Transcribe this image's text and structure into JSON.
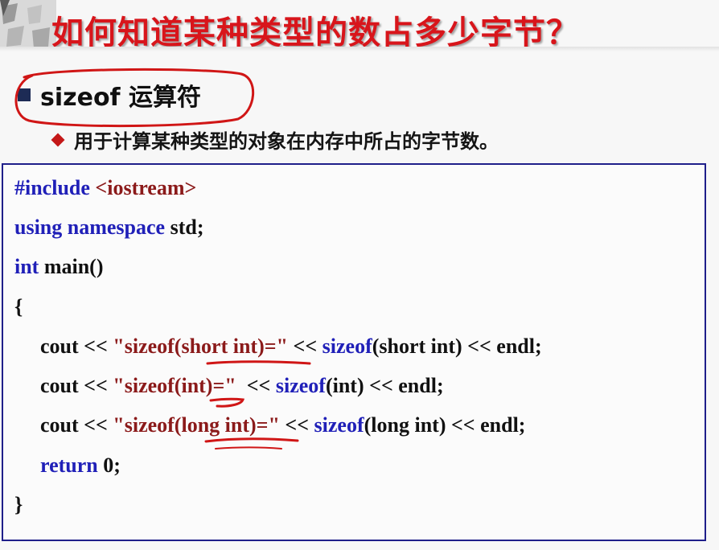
{
  "title": "如何知道某种类型的数占多少字节？",
  "bullet1": "sizeof 运算符",
  "bullet2": "用于计算某种类型的对象在内存中所占的字节数。",
  "code": {
    "l1_pp": "#include",
    "l1_hdr": "<iostream>",
    "l2_kw": "using namespace",
    "l2_rest": "std;",
    "l3_kw": "int",
    "l3_rest": "main()",
    "l4": "{",
    "l5_a": "cout <<",
    "l5_str": "\"sizeof(short int)=\"",
    "l5_b": "<<",
    "l5_kw": "sizeof",
    "l5_c": "(short int) << endl;",
    "l6_a": "cout <<",
    "l6_str": "\"sizeof(int)=\"",
    "l6_b": "<<",
    "l6_kw": "sizeof",
    "l6_c": "(int) << endl;",
    "l7_a": "cout <<",
    "l7_str": "\"sizeof(long int)=\"",
    "l7_b": "<<",
    "l7_kw": "sizeof",
    "l7_c": "(long int) << endl;",
    "l8_kw": "return",
    "l8_rest": "0;",
    "l9": "}"
  },
  "colors": {
    "title": "#d8151b",
    "keyword": "#2020b8",
    "string": "#8b1a1a",
    "box_border": "#1f1f8a",
    "annotation": "#d01616"
  }
}
